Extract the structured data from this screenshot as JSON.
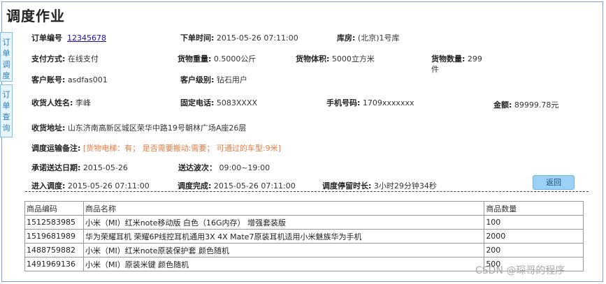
{
  "title": "调度作业",
  "side_tabs": [
    {
      "label": [
        "订",
        "单",
        "调",
        "度"
      ]
    },
    {
      "label": [
        "订",
        "单",
        "查",
        "询"
      ]
    }
  ],
  "order": {
    "order_no_label": "订单编号",
    "order_no": "12345678",
    "order_time_label": "下单时间:",
    "order_time": "2015-05-26 07:11:00",
    "warehouse_label": "库房:",
    "warehouse": "(北京)1号库",
    "payment_label": "支付方式:",
    "payment": "在线支付",
    "weight_label": "货物重量:",
    "weight": "0.5000公斤",
    "volume_label": "货物体积:",
    "volume": "5000立方米",
    "quantity_label": "货物数量:",
    "quantity_a": "299",
    "quantity_b": "件",
    "account_label": "客户账号:",
    "account": "asdfas001",
    "level_label": "客户级别:",
    "level": "钻石用户",
    "receiver_label": "收货人姓名:",
    "receiver": "李峰",
    "phone_label": "固定电话:",
    "phone": "5083XXXX",
    "mobile_label": "手机号码:",
    "mobile": "1709xxxxxxx",
    "amount_label": "金额:",
    "amount": "89999.78元",
    "address_label": "收货地址:",
    "address": "山东济南高新区城区荣华中路19号朝林广场A座26层",
    "remark_label": "调度运输备注:",
    "remark": "[货物电梯：有；   是否需要搬动:需要；  可通过的车型:9米]",
    "promise_date_label": "承诺送达日期:",
    "promise_date": "2015-05-26",
    "wave_label": "送达波次：",
    "wave": "09:00~19:00",
    "enter_label": "进入调度:",
    "enter_time": "2015-05-26 07:11:00",
    "done_label": "调度完成:",
    "done_time": "2015-05-26 07:11:00",
    "stay_label": "调度停留时长:",
    "stay": "3小时29分钟34秒"
  },
  "back_button": "返回",
  "goods_table": {
    "headers": [
      "商品编码",
      "商品名称",
      "商品数量"
    ],
    "rows": [
      [
        "1512583985",
        "小米（MI）红米note移动版 白色（16G内存） 增强套装版",
        "100"
      ],
      [
        "1519681989",
        "华为荣耀耳机 荣耀6P线控耳机通用3X 4X Mate7原装耳机适用小米魅族华为手机",
        "2000"
      ],
      [
        "1488759882",
        "小米（MI）红米note原装保护套 颜色随机",
        "200"
      ],
      [
        "1491969136",
        "小米（MI）原装米键 颜色随机",
        "500"
      ]
    ]
  },
  "watermark": "CSDN @琛哥的程序"
}
